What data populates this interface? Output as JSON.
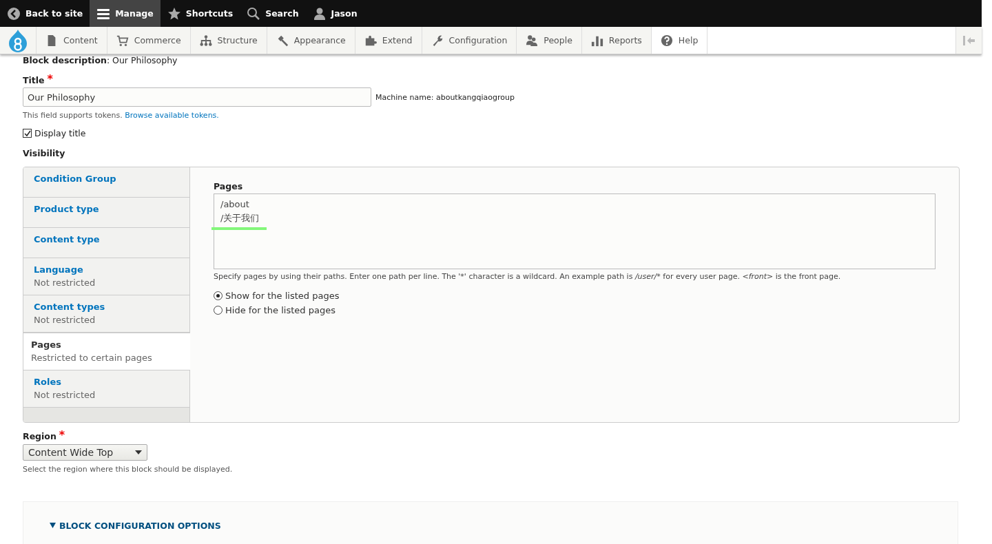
{
  "top_bar": {
    "items": [
      {
        "label": "Back to site",
        "selected": false
      },
      {
        "label": "Manage",
        "selected": true
      },
      {
        "label": "Shortcuts",
        "selected": false
      },
      {
        "label": "Search",
        "selected": false
      },
      {
        "label": "Jason",
        "selected": false
      }
    ]
  },
  "tray": {
    "items": [
      {
        "label": "Content",
        "selected": false
      },
      {
        "label": "Commerce",
        "selected": false
      },
      {
        "label": "Structure",
        "selected": false
      },
      {
        "label": "Appearance",
        "selected": false
      },
      {
        "label": "Extend",
        "selected": false
      },
      {
        "label": "Configuration",
        "selected": false
      },
      {
        "label": "People",
        "selected": false
      },
      {
        "label": "Reports",
        "selected": false
      },
      {
        "label": "Help",
        "selected": true
      }
    ]
  },
  "block_description": {
    "label": "Block description",
    "colon": ":",
    "value": "Our Philosophy"
  },
  "title_field": {
    "label": "Title",
    "required_mark": "*",
    "value": "Our Philosophy",
    "machine_name": "Machine name: aboutkangqiaogroup",
    "help": "This field supports tokens.",
    "help_link": "Browse available tokens."
  },
  "display_title": {
    "label": "Display title",
    "checked": true
  },
  "visibility": {
    "heading": "Visibility",
    "tabs": [
      {
        "title": "Condition Group",
        "selected": false
      },
      {
        "title": "Product type",
        "selected": false
      },
      {
        "title": "Content type",
        "selected": false
      },
      {
        "title": "Language",
        "summary": "Not restricted",
        "selected": false
      },
      {
        "title": "Content types",
        "summary": "Not restricted",
        "selected": false
      },
      {
        "title": "Pages",
        "summary": "Restricted to certain pages",
        "selected": true
      },
      {
        "title": "Roles",
        "summary": "Not restricted",
        "selected": false
      }
    ],
    "pages": {
      "label": "Pages",
      "lines": [
        "/about",
        "/关于我们"
      ],
      "description_parts": [
        {
          "text": "Specify pages by using their paths. Enter one path per line. The '*' character is a wildcard. An example path is ",
          "italic": false
        },
        {
          "text": "/user/*",
          "italic": true
        },
        {
          "text": " for every user page. ",
          "italic": false
        },
        {
          "text": "<front>",
          "italic": true
        },
        {
          "text": " is the front page.",
          "italic": false
        }
      ],
      "options": [
        {
          "label": "Show for the listed pages",
          "selected": true
        },
        {
          "label": "Hide for the listed pages",
          "selected": false
        }
      ]
    }
  },
  "region": {
    "label": "Region",
    "required_mark": "*",
    "value": "Content Wide Top",
    "help": "Select the region where this block should be displayed."
  },
  "details": {
    "summary": "BLOCK CONFIGURATION OPTIONS",
    "expanded": true
  }
}
